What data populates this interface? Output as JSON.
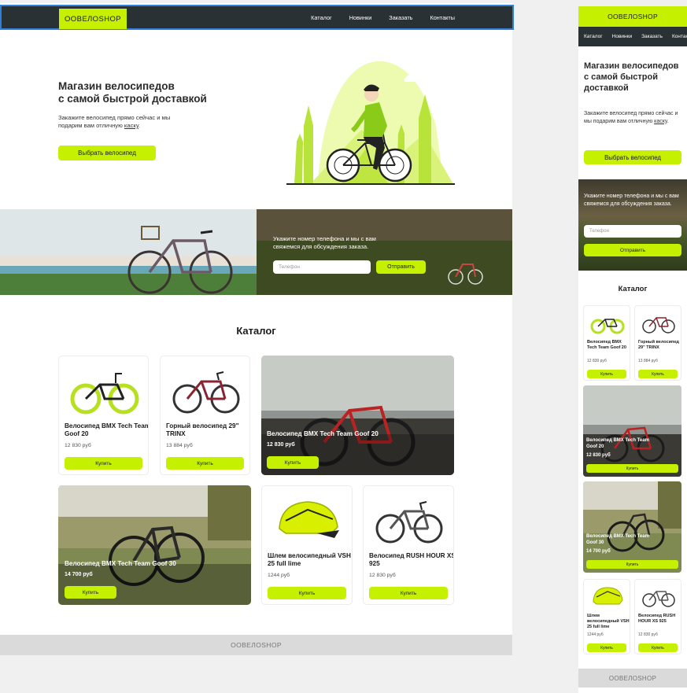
{
  "brand": "ООВЕЛОSHOP",
  "nav": [
    "Каталог",
    "Новинки",
    "Заказать",
    "Контакты"
  ],
  "hero": {
    "title_line1": "Магазин велосипедов",
    "title_line2": "с самой быстрой доставкой",
    "text_before": "Закажите велосипед прямо сейчас и мы подарим вам отличную ",
    "text_link": "каску",
    "text_after": ".",
    "button": "Выбрать велосипед"
  },
  "callback": {
    "text": "Укажите номер телефона и мы с вам свяжемся для обсуждения заказа.",
    "placeholder": "Телефон",
    "button": "Отправить"
  },
  "catalog": {
    "title": "Каталог",
    "buy_label": "Купить",
    "products": [
      {
        "name": "Велосипед BMX Tech Team Goof 20",
        "price": "12 830 руб"
      },
      {
        "name": "Горный велосипед 29\" TRINX",
        "price": "13 884 руб"
      },
      {
        "name": "Велосипед BMX Tech Team Goof 20",
        "price": "12 830 руб"
      },
      {
        "name": "Велосипед BMX Tech Team Goof 30",
        "price": "14 700 руб"
      },
      {
        "name": "Шлем велосипедный VSH 25 full lime",
        "price": "1244 руб"
      },
      {
        "name": "Велосипед RUSH HOUR XS 925",
        "price": "12 830 руб"
      }
    ]
  },
  "footer": "ООВЕЛОSHOP",
  "colors": {
    "accent": "#c5f000",
    "dark": "#2a3134",
    "footer": "#dadada"
  }
}
